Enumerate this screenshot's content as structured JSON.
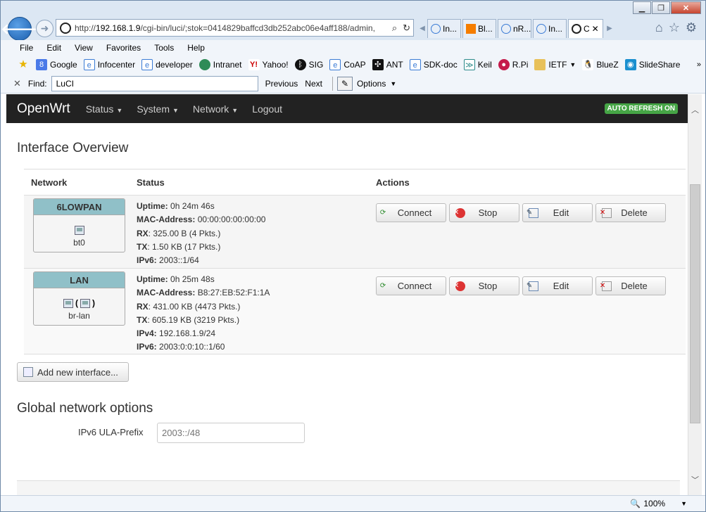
{
  "browser": {
    "url_prefix": "http://",
    "url_host": "192.168.1.9",
    "url_path": "/cgi-bin/luci/;stok=0414829baffcd3db252abc06e4aff188/admin,",
    "tabs": [
      {
        "label": "In..."
      },
      {
        "label": "Bl..."
      },
      {
        "label": "nR..."
      },
      {
        "label": "In..."
      },
      {
        "label": "C"
      }
    ],
    "menu": [
      "File",
      "Edit",
      "View",
      "Favorites",
      "Tools",
      "Help"
    ],
    "favorites": [
      "Google",
      "Infocenter",
      "developer",
      "Intranet",
      "Yahoo!",
      "SIG",
      "CoAP",
      "ANT",
      "SDK-doc",
      "Keil",
      "R.Pi",
      "IETF",
      "BlueZ",
      "SlideShare"
    ],
    "find": {
      "label": "Find:",
      "value": "LuCI",
      "previous": "Previous",
      "next": "Next",
      "options": "Options"
    },
    "zoom": "100%"
  },
  "header": {
    "brand": "OpenWrt",
    "nav": [
      "Status",
      "System",
      "Network",
      "Logout"
    ],
    "refresh_badge": "AUTO REFRESH ON"
  },
  "page": {
    "title": "Interface Overview",
    "columns": {
      "network": "Network",
      "status": "Status",
      "actions": "Actions"
    },
    "interfaces": [
      {
        "name": "6LOWPAN",
        "device": "bt0",
        "status": [
          {
            "k": "Uptime:",
            "v": "0h 24m 46s"
          },
          {
            "k": "MAC-Address:",
            "v": "00:00:00:00:00:00"
          },
          {
            "k": "RX",
            "v": ": 325.00 B (4 Pkts.)"
          },
          {
            "k": "TX",
            "v": ": 1.50 KB (17 Pkts.)"
          },
          {
            "k": "IPv6:",
            "v": "2003::1/64"
          }
        ]
      },
      {
        "name": "LAN",
        "device": "br-lan",
        "status": [
          {
            "k": "Uptime:",
            "v": "0h 25m 48s"
          },
          {
            "k": "MAC-Address:",
            "v": "B8:27:EB:52:F1:1A"
          },
          {
            "k": "RX",
            "v": ": 431.00 KB (4473 Pkts.)"
          },
          {
            "k": "TX",
            "v": ": 605.19 KB (3219 Pkts.)"
          },
          {
            "k": "IPv4:",
            "v": "192.168.1.9/24"
          },
          {
            "k": "IPv6:",
            "v": "2003:0:0:10::1/60"
          }
        ]
      }
    ],
    "actions": {
      "connect": "Connect",
      "stop": "Stop",
      "edit": "Edit",
      "delete": "Delete"
    },
    "add_button": "Add new interface...",
    "global_title": "Global network options",
    "ula_label": "IPv6 ULA-Prefix",
    "ula_placeholder": "2003::/48"
  },
  "colors": {
    "header_bg": "#222222",
    "refresh_badge": "#46a546",
    "iface_header": "#90c0c8"
  }
}
